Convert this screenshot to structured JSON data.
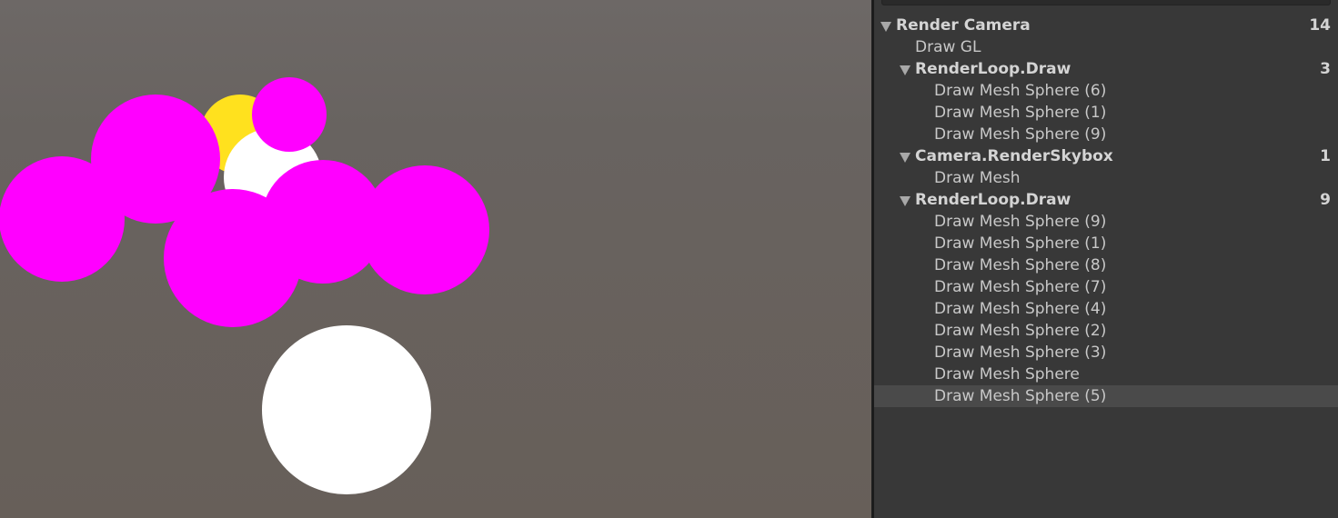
{
  "scene": {
    "colors": {
      "magenta": "#ff00ff",
      "yellow": "#ffe11e",
      "white": "#ffffff"
    }
  },
  "frame_debugger": {
    "rows": [
      {
        "label": "Render Camera",
        "count": "14",
        "level": 0,
        "expandable": true
      },
      {
        "label": "Draw GL",
        "count": "",
        "level": 1,
        "expandable": false
      },
      {
        "label": "RenderLoop.Draw",
        "count": "3",
        "level": 1,
        "expandable": true
      },
      {
        "label": "Draw Mesh Sphere (6)",
        "count": "",
        "level": 2,
        "expandable": false
      },
      {
        "label": "Draw Mesh Sphere (1)",
        "count": "",
        "level": 2,
        "expandable": false
      },
      {
        "label": "Draw Mesh Sphere (9)",
        "count": "",
        "level": 2,
        "expandable": false
      },
      {
        "label": "Camera.RenderSkybox",
        "count": "1",
        "level": 1,
        "expandable": true
      },
      {
        "label": "Draw Mesh",
        "count": "",
        "level": 2,
        "expandable": false
      },
      {
        "label": "RenderLoop.Draw",
        "count": "9",
        "level": 1,
        "expandable": true
      },
      {
        "label": "Draw Mesh Sphere (9)",
        "count": "",
        "level": 2,
        "expandable": false
      },
      {
        "label": "Draw Mesh Sphere (1)",
        "count": "",
        "level": 2,
        "expandable": false
      },
      {
        "label": "Draw Mesh Sphere (8)",
        "count": "",
        "level": 2,
        "expandable": false
      },
      {
        "label": "Draw Mesh Sphere (7)",
        "count": "",
        "level": 2,
        "expandable": false
      },
      {
        "label": "Draw Mesh Sphere (4)",
        "count": "",
        "level": 2,
        "expandable": false
      },
      {
        "label": "Draw Mesh Sphere (2)",
        "count": "",
        "level": 2,
        "expandable": false
      },
      {
        "label": "Draw Mesh Sphere (3)",
        "count": "",
        "level": 2,
        "expandable": false
      },
      {
        "label": "Draw Mesh Sphere",
        "count": "",
        "level": 2,
        "expandable": false
      },
      {
        "label": "Draw Mesh Sphere (5)",
        "count": "",
        "level": 2,
        "expandable": false,
        "selected": true
      }
    ]
  }
}
